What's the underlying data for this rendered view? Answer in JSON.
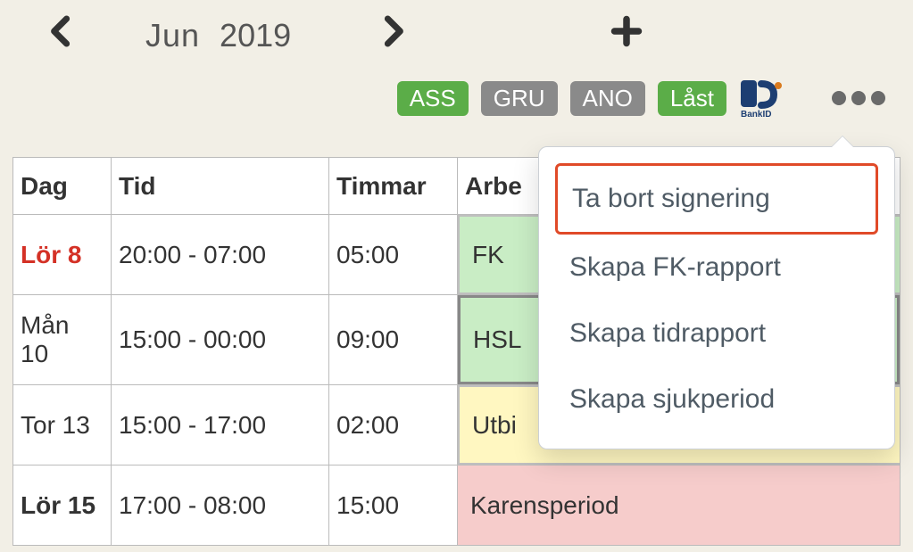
{
  "nav": {
    "month": "Jun",
    "year": "2019"
  },
  "filters": {
    "ass": "ASS",
    "gru": "GRU",
    "ano": "ANO",
    "locked": "Låst"
  },
  "headers": {
    "day": "Dag",
    "time": "Tid",
    "hours": "Timmar",
    "work": "Arbe"
  },
  "rows": [
    {
      "day": "Lör 8",
      "time": "20:00 - 07:00",
      "hours": "05:00",
      "work": "FK",
      "day_style": "weekend-red",
      "chip": "chip-green"
    },
    {
      "day": "Mån 10",
      "time": "15:00 - 00:00",
      "hours": "09:00",
      "work": "HSL",
      "day_style": "",
      "chip": "chip-green2"
    },
    {
      "day": "Tor 13",
      "time": "15:00 - 17:00",
      "hours": "02:00",
      "work": "Utbi",
      "day_style": "",
      "chip": "chip-yellow"
    },
    {
      "day": "Lör 15",
      "time": "17:00 - 08:00",
      "hours": "15:00",
      "work": "Karensperiod",
      "day_style": "weekend-bold",
      "chip": "chip-pink"
    }
  ],
  "menu": {
    "remove_signature": "Ta bort signering",
    "create_fk_report": "Skapa FK-rapport",
    "create_timereport": "Skapa tidrapport",
    "create_sickperiod": "Skapa sjukperiod"
  },
  "bankid_label": "BankID"
}
